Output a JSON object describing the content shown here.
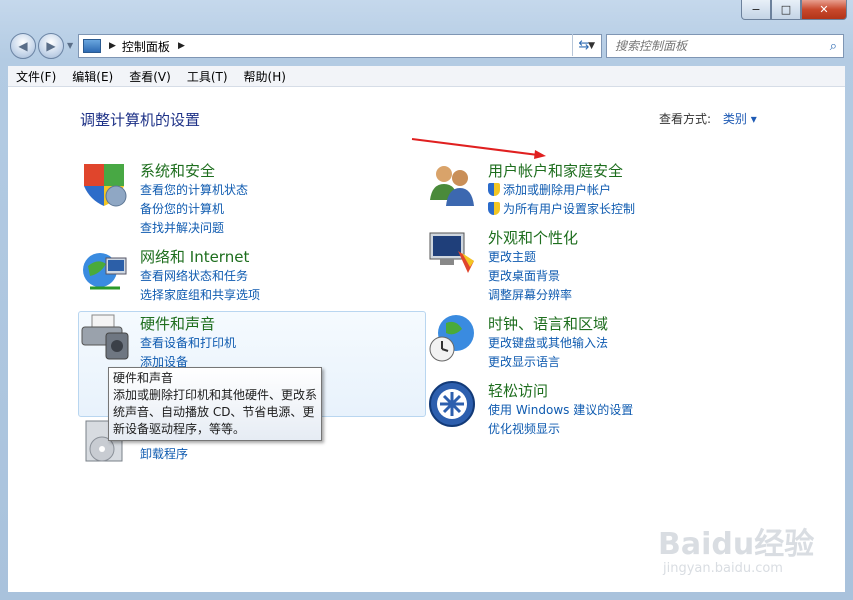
{
  "window": {
    "caption_buttons": {
      "minimize": "−",
      "maximize": "□",
      "close": "✕"
    }
  },
  "nav": {
    "breadcrumb": "控制面板",
    "search_placeholder": "搜索控制面板"
  },
  "menu": [
    "文件(F)",
    "编辑(E)",
    "查看(V)",
    "工具(T)",
    "帮助(H)"
  ],
  "main": {
    "title": "调整计算机的设置",
    "view_by_label": "查看方式:",
    "view_by_value": "类别"
  },
  "categories": {
    "system": {
      "title": "系统和安全",
      "links": [
        "查看您的计算机状态",
        "备份您的计算机",
        "查找并解决问题"
      ]
    },
    "network": {
      "title": "网络和 Internet",
      "links": [
        "查看网络状态和任务",
        "选择家庭组和共享选项"
      ]
    },
    "hardware": {
      "title": "硬件和声音",
      "links": [
        "查看设备和打印机",
        "添加设备"
      ]
    },
    "programs": {
      "links": [
        "卸载程序"
      ]
    },
    "users": {
      "title": "用户帐户和家庭安全",
      "links": [
        "添加或删除用户帐户",
        "为所有用户设置家长控制"
      ]
    },
    "appearance": {
      "title": "外观和个性化",
      "links": [
        "更改主题",
        "更改桌面背景",
        "调整屏幕分辨率"
      ]
    },
    "clock": {
      "title": "时钟、语言和区域",
      "links": [
        "更改键盘或其他输入法",
        "更改显示语言"
      ]
    },
    "ease": {
      "title": "轻松访问",
      "links": [
        "使用 Windows 建议的设置",
        "优化视频显示"
      ]
    }
  },
  "tooltip": {
    "title": "硬件和声音",
    "body": "添加或删除打印机和其他硬件、更改系统声音、自动播放 CD、节省电源、更新设备驱动程序，等等。"
  },
  "watermark": {
    "logo": "Baidu经验",
    "url": "jingyan.baidu.com"
  },
  "colors": {
    "category_title": "#1e6e1e",
    "link": "#0f5bb0",
    "page_title": "#1e3287",
    "arrow": "#e02020"
  }
}
